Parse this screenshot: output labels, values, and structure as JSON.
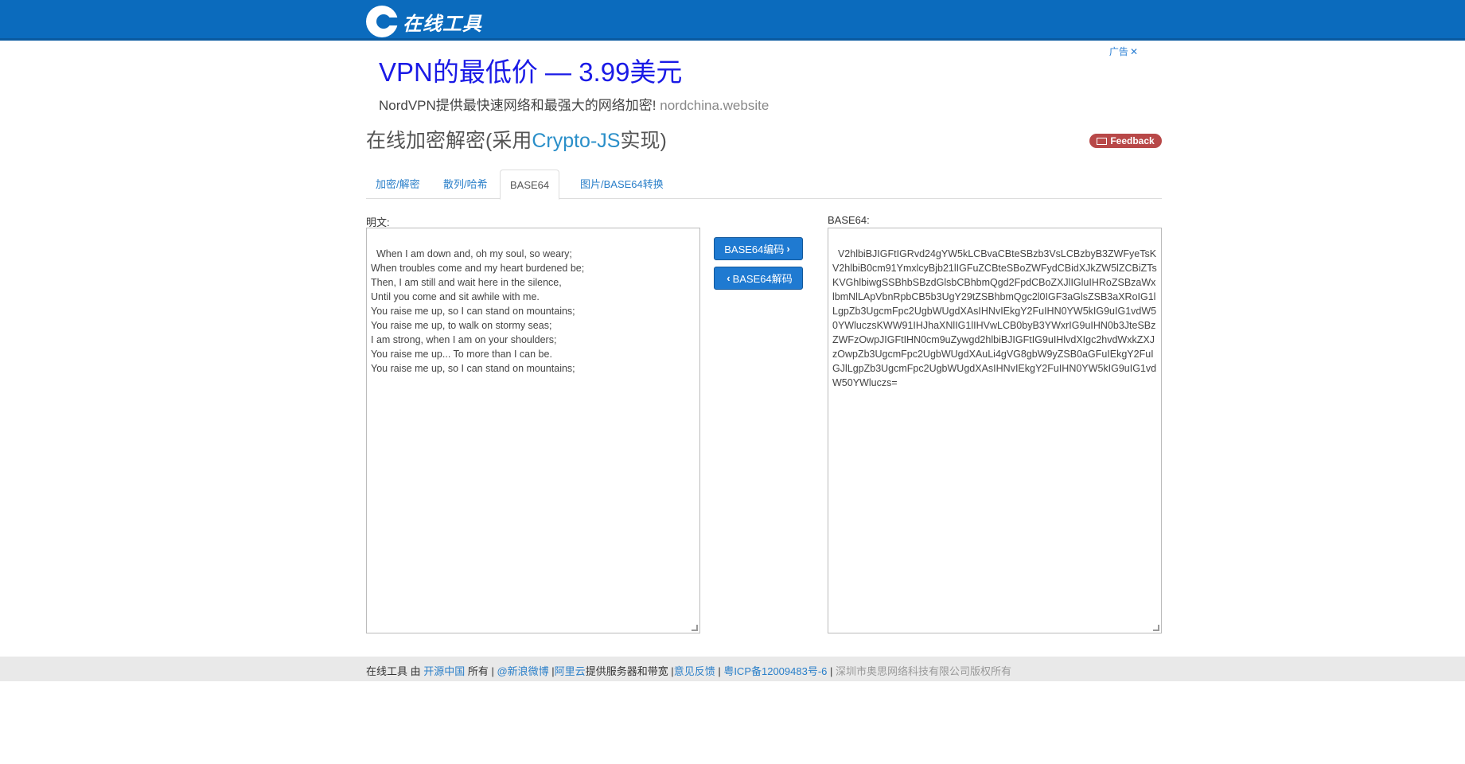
{
  "header": {
    "logo_text": "在线工具"
  },
  "ad": {
    "title": "VPN的最低价 — 3.99美元",
    "desc": "NordVPN提供最快速网络和最强大的网络加密!",
    "url": "nordchina.website",
    "badge": "广告",
    "close": "✕"
  },
  "page": {
    "title_prefix": "在线加密解密(采用",
    "title_accent": "Crypto-JS",
    "title_suffix": "实现)",
    "feedback_label": "Feedback"
  },
  "tabs": [
    {
      "label": "加密/解密",
      "active": false
    },
    {
      "label": "散列/哈希",
      "active": false
    },
    {
      "label": "BASE64",
      "active": true
    },
    {
      "label": "图片/BASE64转换",
      "active": false
    }
  ],
  "plain": {
    "label": "明文:",
    "value": "When I am down and, oh my soul, so weary;\nWhen troubles come and my heart burdened be;\nThen, I am still and wait here in the silence,\nUntil you come and sit awhile with me.\nYou raise me up, so I can stand on mountains;\nYou raise me up, to walk on stormy seas;\nI am strong, when I am on your shoulders;\nYou raise me up... To more than I can be.\nYou raise me up, so I can stand on mountains;"
  },
  "encoded": {
    "label": "BASE64:",
    "value": "V2hlbiBJIGFtIGRvd24gYW5kLCBvaCBteSBzb3VsLCBzbyB3ZWFyeTsKV2hlbiB0cm91YmxlcyBjb21lIGFuZCBteSBoZWFydCBidXJkZW5lZCBiZTsKVGhlbiwgSSBhbSBzdGlsbCBhbmQgd2FpdCBoZXJlIGluIHRoZSBzaWxlbmNlLApVbnRpbCB5b3UgY29tZSBhbmQgc2l0IGF3aGlsZSB3aXRoIG1lLgpZb3UgcmFpc2UgbWUgdXAsIHNvIEkgY2FuIHN0YW5kIG9uIG1vdW50YWluczsKWW91IHJhaXNlIG1lIHVwLCB0byB3YWxrIG9uIHN0b3JteSBzZWFzOwpJIGFtIHN0cm9uZywgd2hlbiBJIGFtIG9uIHlvdXIgc2hvdWxkZXJzOwpZb3UgcmFpc2UgbWUgdXAuLi4gVG8gbW9yZSB0aGFuIEkgY2FuIGJlLgpZb3UgcmFpc2UgbWUgdXAsIHNvIEkgY2FuIHN0YW5kIG9uIG1vdW50YWluczs="
  },
  "buttons": {
    "encode_label": "BASE64编码",
    "decode_label": "BASE64解码"
  },
  "footer": {
    "t1": "在线工具 由 ",
    "l1": "开源中国",
    "t2": " 所有 | ",
    "l2": "@新浪微博",
    "t3": " |",
    "l3": "阿里云",
    "t4": "提供服务器和带宽 |",
    "l4": "意见反馈",
    "t5": " | ",
    "l5": "粤ICP备12009483号-6",
    "t6": " | ",
    "m1": "深圳市奥思网络科技有限公司版权所有"
  },
  "colors": {
    "brand": "#0b6bbd",
    "link": "#2a7fc9",
    "button": "#1f7ad1",
    "feedback": "#b84848"
  }
}
